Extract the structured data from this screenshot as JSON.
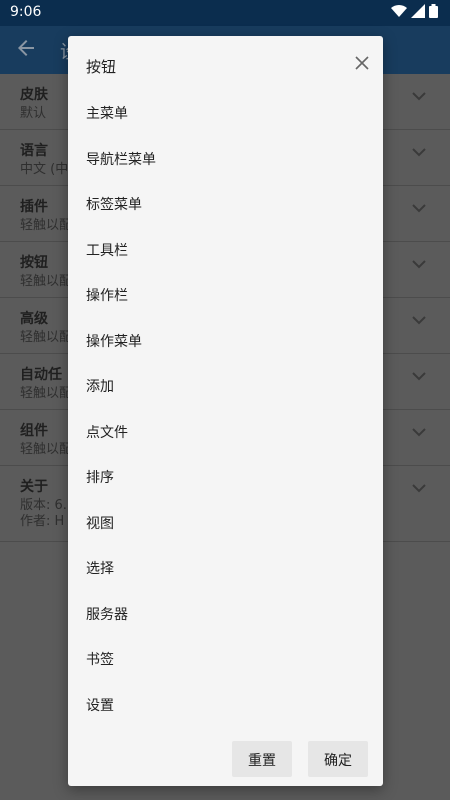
{
  "status_bar": {
    "time": "9:06"
  },
  "app_bar": {
    "title": "设"
  },
  "settings": [
    {
      "title": "皮肤",
      "subtitle": "默认"
    },
    {
      "title": "语言",
      "subtitle": "中文 (中"
    },
    {
      "title": "插件",
      "subtitle": "轻触以配"
    },
    {
      "title": "按钮",
      "subtitle": "轻触以配"
    },
    {
      "title": "高级",
      "subtitle": "轻触以配"
    },
    {
      "title": "自动任",
      "subtitle": "轻触以配"
    },
    {
      "title": "组件",
      "subtitle": "轻触以配"
    },
    {
      "title": "关于",
      "subtitle": "版本: 6.",
      "subtitle2": "作者: H"
    }
  ],
  "dialog": {
    "title": "按钮",
    "items": [
      "主菜单",
      "导航栏菜单",
      "标签菜单",
      "工具栏",
      "操作栏",
      "操作菜单",
      "添加",
      "点文件",
      "排序",
      "视图",
      "选择",
      "服务器",
      "书签",
      "设置"
    ],
    "reset_label": "重置",
    "ok_label": "确定"
  }
}
